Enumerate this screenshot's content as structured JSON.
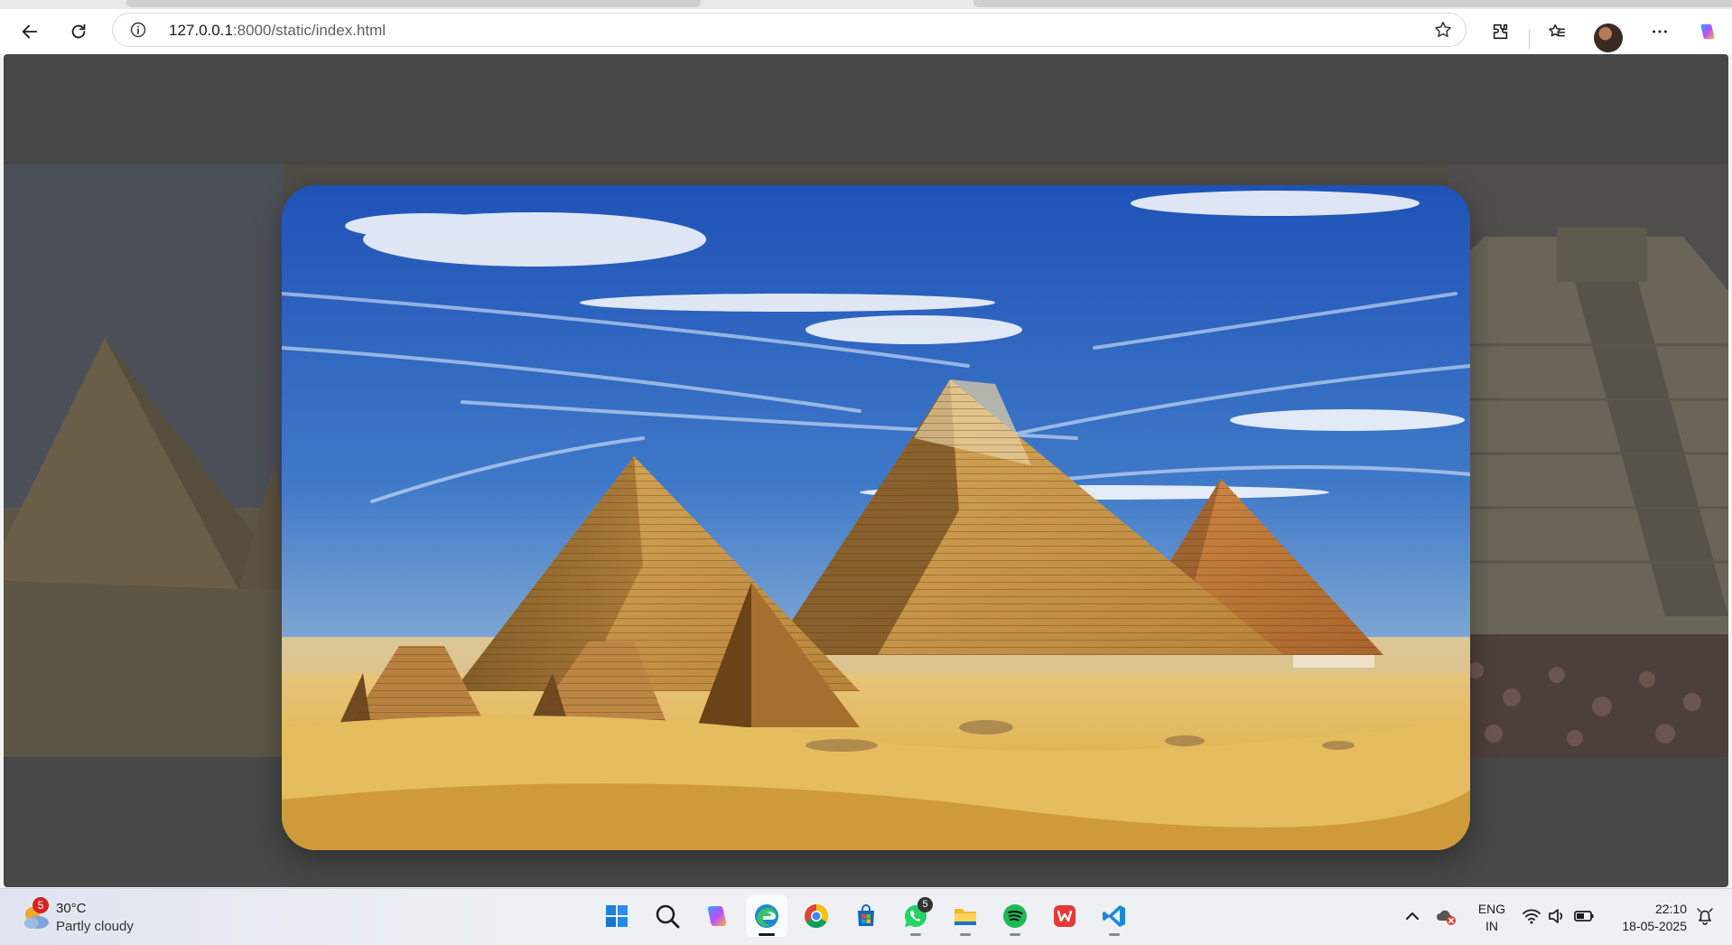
{
  "browser": {
    "url_host": "127.0.0.1",
    "url_rest": ":8000/static/index.html",
    "icons": [
      "back-arrow-icon",
      "refresh-icon",
      "info-icon",
      "favorite-star-icon",
      "extensions-icon",
      "favorites-icon",
      "profile-avatar",
      "more-icon",
      "copilot-icon"
    ]
  },
  "taskbar": {
    "weather": {
      "badge": "5",
      "temp": "30°C",
      "condition": "Partly cloudy"
    },
    "apps": [
      {
        "name": "start",
        "icon": "windows-icon"
      },
      {
        "name": "search",
        "icon": "search-icon"
      },
      {
        "name": "copilot",
        "icon": "copilot-icon"
      },
      {
        "name": "edge",
        "icon": "edge-icon"
      },
      {
        "name": "chrome",
        "icon": "chrome-icon"
      },
      {
        "name": "store",
        "icon": "store-icon"
      },
      {
        "name": "whatsapp",
        "icon": "whatsapp-icon",
        "badge": "5"
      },
      {
        "name": "file-explorer",
        "icon": "folder-icon"
      },
      {
        "name": "spotify",
        "icon": "spotify-icon"
      },
      {
        "name": "wps",
        "icon": "wps-icon"
      },
      {
        "name": "vscode",
        "icon": "vscode-icon"
      }
    ],
    "tray": {
      "lang_1": "ENG",
      "lang_2": "IN",
      "time": "22:10",
      "date": "18-05-2025"
    }
  },
  "colors": {
    "page_bg": "#474747",
    "sky_top": "#1f52b7",
    "sand": "#e2b85a",
    "pyramid": "#c9964a"
  }
}
